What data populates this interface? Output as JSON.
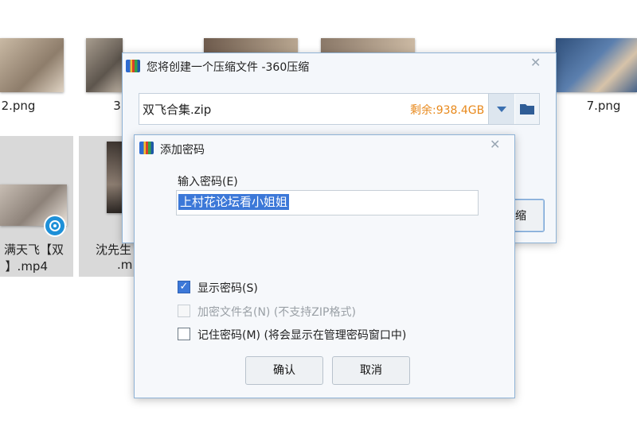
{
  "background": {
    "files": [
      {
        "name": "2.png"
      },
      {
        "name": "3"
      },
      {
        "name": ""
      },
      {
        "name": ""
      },
      {
        "name": "7.png"
      }
    ],
    "videos": [
      {
        "line1": "满天飞【双",
        "line2": "】.mp4"
      },
      {
        "line1": "沈先生",
        "line2": ".m"
      }
    ]
  },
  "compress_window": {
    "title": "您将创建一个压缩文件 -360压缩",
    "filename": "双飞合集.zip",
    "remaining": "剩余:938.4GB",
    "partial_button": "缩",
    "close_icon": "close-icon"
  },
  "password_dialog": {
    "title": "添加密码",
    "prompt_label": "输入密码(E)",
    "password_value": "上村花论坛看小姐姐",
    "options": [
      {
        "label": "显示密码(S)",
        "checked": true,
        "disabled": false
      },
      {
        "label": "加密文件名(N) (不支持ZIP格式)",
        "checked": false,
        "disabled": true
      },
      {
        "label": "记住密码(M) (将会显示在管理密码窗口中)",
        "checked": false,
        "disabled": false
      }
    ],
    "ok_label": "确认",
    "cancel_label": "取消"
  },
  "colors": {
    "remaining_text": "#e8891c",
    "selection_highlight": "#3c78d8",
    "window_border": "#8fb3d6"
  }
}
